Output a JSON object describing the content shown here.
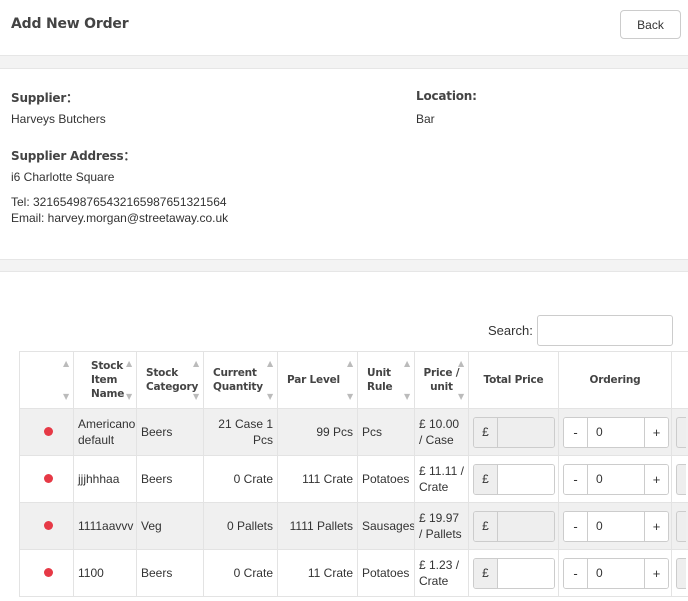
{
  "header": {
    "title": "Add New Order",
    "back_label": "Back"
  },
  "supplier": {
    "label": "Supplier：",
    "name": "Harveys Butchers",
    "address_label": "Supplier Address：",
    "address": "i6 Charlotte Square",
    "tel": "Tel: 3216549876543216598765132156​4",
    "email": "Email: harvey.morgan@streetaway.co.uk"
  },
  "location": {
    "label": "Location:",
    "value": "Bar"
  },
  "search": {
    "label": "Search:",
    "placeholder": ""
  },
  "table": {
    "columns": [
      "",
      "Stock Item Name",
      "Stock Category",
      "Current Quantity",
      "Par Level",
      "Unit Rule",
      "Price / unit",
      "Total Price",
      "Ordering"
    ],
    "currency_symbol": "£",
    "rows": [
      {
        "name": "Americano default",
        "category": "Beers",
        "current_qty": "21 Case 1 Pcs",
        "par_level": "99 Pcs",
        "unit_rule": "Pcs",
        "price": "£ 10.00 / Case",
        "ordering": "0"
      },
      {
        "name": "jjjhhhaa",
        "category": "Beers",
        "current_qty": "0 Crate",
        "par_level": "111 Crate",
        "unit_rule": "Potatoes",
        "price": "£ 11.11 / Crate",
        "ordering": "0"
      },
      {
        "name": "1111aavvv",
        "category": "Veg",
        "current_qty": "0 Pallets",
        "par_level": "1111 Pallets",
        "unit_rule": "Sausages",
        "price": "£ 19.97 / Pallets",
        "ordering": "0"
      },
      {
        "name": "1100",
        "category": "Beers",
        "current_qty": "0 Crate",
        "par_level": "11 Crate",
        "unit_rule": "Potatoes",
        "price": "£ 1.23 / Crate",
        "ordering": "0"
      }
    ]
  },
  "colors": {
    "status_dot": "#e63946"
  },
  "icons": {
    "sort": "sort-arrows-icon",
    "status": "status-dot-icon"
  }
}
